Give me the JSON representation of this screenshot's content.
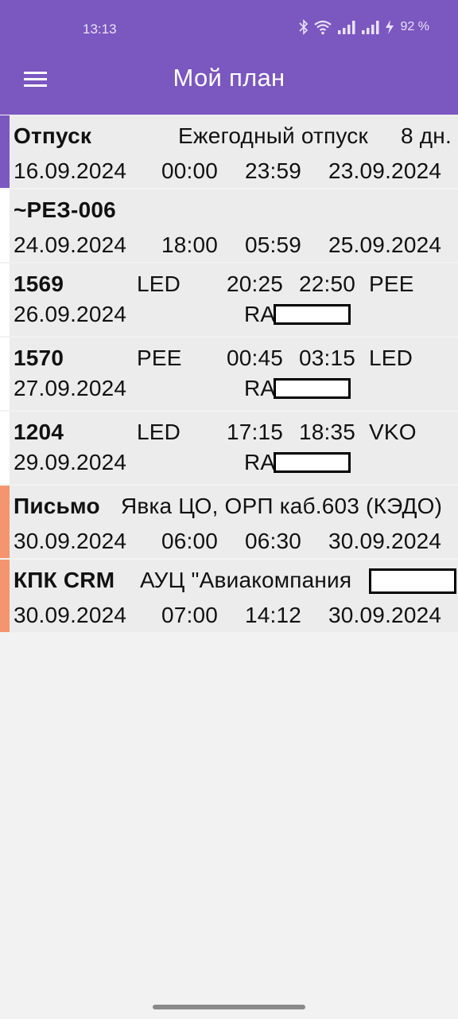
{
  "status_bar": {
    "time": "13:13",
    "battery": "92 %",
    "icons": [
      "bluetooth-icon",
      "wifi-icon",
      "signal-icon",
      "signal-icon",
      "charging-icon"
    ]
  },
  "app_bar": {
    "title": "Мой план",
    "menu_icon": "hamburger-menu-icon",
    "color": "#7b57c0"
  },
  "plan": [
    {
      "accent": "#7b57c0",
      "title": "Отпуск",
      "description": "Ежегодный отпуск",
      "duration": "8 дн.",
      "start_date": "16.09.2024",
      "start_time": "00:00",
      "end_time": "23:59",
      "end_date": "23.09.2024"
    },
    {
      "accent": "#ffffff",
      "title": "~РЕЗ-006",
      "start_date": "24.09.2024",
      "start_time": "18:00",
      "end_time": "05:59",
      "end_date": "25.09.2024"
    },
    {
      "accent": "#ffffff",
      "flight": "1569",
      "from": "LED",
      "dep": "20:25",
      "arr": "22:50",
      "to": "PEE",
      "date": "26.09.2024",
      "aircraft": "RA"
    },
    {
      "accent": "#ffffff",
      "flight": "1570",
      "from": "PEE",
      "dep": "00:45",
      "arr": "03:15",
      "to": "LED",
      "date": "27.09.2024",
      "aircraft": "RA"
    },
    {
      "accent": "#ffffff",
      "flight": "1204",
      "from": "LED",
      "dep": "17:15",
      "arr": "18:35",
      "to": "VKO",
      "date": "29.09.2024",
      "aircraft": "RA"
    },
    {
      "accent": "#f4956f",
      "title": "Письмо",
      "description": "Явка ЦО, ОРП каб.603 (КЭДО)",
      "start_date": "30.09.2024",
      "start_time": "06:00",
      "end_time": "06:30",
      "end_date": "30.09.2024"
    },
    {
      "accent": "#f4956f",
      "title": "КПК CRM",
      "description": "АУЦ \"Авиакомпания",
      "start_date": "30.09.2024",
      "start_time": "07:00",
      "end_time": "14:12",
      "end_date": "30.09.2024"
    }
  ]
}
